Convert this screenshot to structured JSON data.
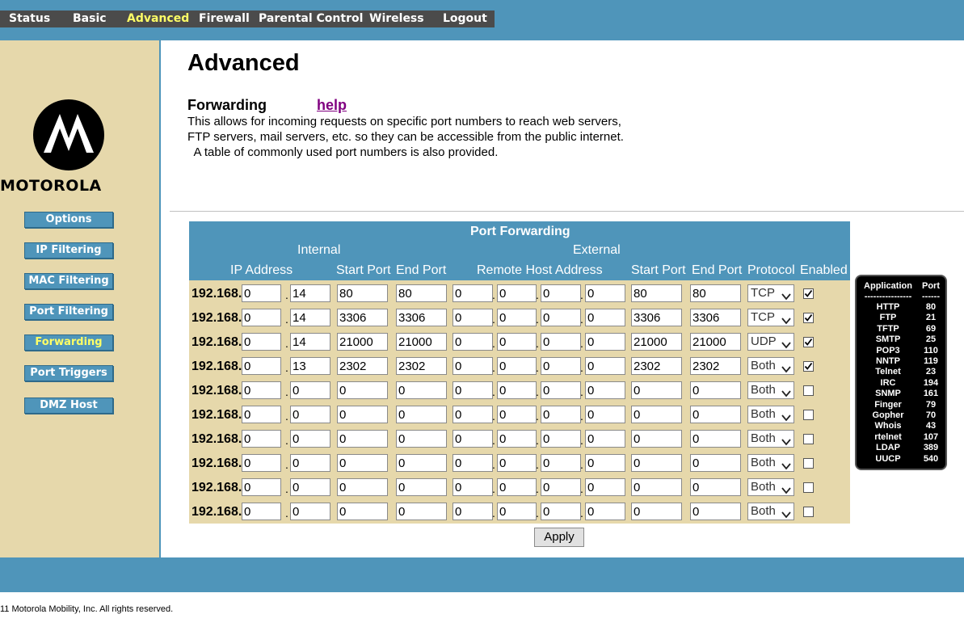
{
  "nav": [
    "Status",
    "Basic",
    "Advanced",
    "Firewall",
    "Parental Control",
    "Wireless",
    "Logout"
  ],
  "active_nav": "Advanced",
  "brand": "MOTOROLA",
  "sidebar": [
    "Options",
    "IP Filtering",
    "MAC Filtering",
    "Port Filtering",
    "Forwarding",
    "Port Triggers",
    "DMZ Host"
  ],
  "active_sidebar": "Forwarding",
  "page_title": "Advanced",
  "section_title": "Forwarding",
  "help_label": "help",
  "description": [
    "This allows for incoming requests on specific port numbers to reach  web servers,",
    "FTP servers, mail servers, etc. so they can be accessible from the public internet.",
    "  A table of commonly used port numbers is also provided."
  ],
  "table": {
    "title": "Port Forwarding",
    "group_internal": "Internal",
    "group_external": "External",
    "col_ip": "IP Address",
    "col_start": "Start Port",
    "col_end": "End Port",
    "col_remote": "Remote Host Address",
    "col_ext_start": "Start Port",
    "col_ext_end": "End Port",
    "col_protocol": "Protocol",
    "col_enabled": "Enabled",
    "ip_prefix": "192.168.",
    "rows": [
      {
        "ip3": "0",
        "ip4": "14",
        "start": "80",
        "end": "80",
        "r1": "0",
        "r2": "0",
        "r3": "0",
        "r4": "0",
        "ext_start": "80",
        "ext_end": "80",
        "protocol": "TCP",
        "enabled": true
      },
      {
        "ip3": "0",
        "ip4": "14",
        "start": "3306",
        "end": "3306",
        "r1": "0",
        "r2": "0",
        "r3": "0",
        "r4": "0",
        "ext_start": "3306",
        "ext_end": "3306",
        "protocol": "TCP",
        "enabled": true
      },
      {
        "ip3": "0",
        "ip4": "14",
        "start": "21000",
        "end": "21000",
        "r1": "0",
        "r2": "0",
        "r3": "0",
        "r4": "0",
        "ext_start": "21000",
        "ext_end": "21000",
        "protocol": "UDP",
        "enabled": true
      },
      {
        "ip3": "0",
        "ip4": "13",
        "start": "2302",
        "end": "2302",
        "r1": "0",
        "r2": "0",
        "r3": "0",
        "r4": "0",
        "ext_start": "2302",
        "ext_end": "2302",
        "protocol": "Both",
        "enabled": true
      },
      {
        "ip3": "0",
        "ip4": "0",
        "start": "0",
        "end": "0",
        "r1": "0",
        "r2": "0",
        "r3": "0",
        "r4": "0",
        "ext_start": "0",
        "ext_end": "0",
        "protocol": "Both",
        "enabled": false
      },
      {
        "ip3": "0",
        "ip4": "0",
        "start": "0",
        "end": "0",
        "r1": "0",
        "r2": "0",
        "r3": "0",
        "r4": "0",
        "ext_start": "0",
        "ext_end": "0",
        "protocol": "Both",
        "enabled": false
      },
      {
        "ip3": "0",
        "ip4": "0",
        "start": "0",
        "end": "0",
        "r1": "0",
        "r2": "0",
        "r3": "0",
        "r4": "0",
        "ext_start": "0",
        "ext_end": "0",
        "protocol": "Both",
        "enabled": false
      },
      {
        "ip3": "0",
        "ip4": "0",
        "start": "0",
        "end": "0",
        "r1": "0",
        "r2": "0",
        "r3": "0",
        "r4": "0",
        "ext_start": "0",
        "ext_end": "0",
        "protocol": "Both",
        "enabled": false
      },
      {
        "ip3": "0",
        "ip4": "0",
        "start": "0",
        "end": "0",
        "r1": "0",
        "r2": "0",
        "r3": "0",
        "r4": "0",
        "ext_start": "0",
        "ext_end": "0",
        "protocol": "Both",
        "enabled": false
      },
      {
        "ip3": "0",
        "ip4": "0",
        "start": "0",
        "end": "0",
        "r1": "0",
        "r2": "0",
        "r3": "0",
        "r4": "0",
        "ext_start": "0",
        "ext_end": "0",
        "protocol": "Both",
        "enabled": false
      }
    ]
  },
  "apply_label": "Apply",
  "ports_panel": {
    "col_app": "Application",
    "col_port": "Port",
    "sep_app": "----------------",
    "sep_port": "------",
    "rows": [
      {
        "app": "HTTP",
        "port": "80"
      },
      {
        "app": "FTP",
        "port": "21"
      },
      {
        "app": "TFTP",
        "port": "69"
      },
      {
        "app": "SMTP",
        "port": "25"
      },
      {
        "app": "POP3",
        "port": "110"
      },
      {
        "app": "NNTP",
        "port": "119"
      },
      {
        "app": "Telnet",
        "port": "23"
      },
      {
        "app": "IRC",
        "port": "194"
      },
      {
        "app": "SNMP",
        "port": "161"
      },
      {
        "app": "Finger",
        "port": "79"
      },
      {
        "app": "Gopher",
        "port": "70"
      },
      {
        "app": "Whois",
        "port": "43"
      },
      {
        "app": "rtelnet",
        "port": "107"
      },
      {
        "app": "LDAP",
        "port": "389"
      },
      {
        "app": "UUCP",
        "port": "540"
      }
    ]
  },
  "copyright": "11 Motorola Mobility, Inc. All rights reserved.",
  "colors": {
    "header": "#4f95ba",
    "sidebar": "#e6d8ab",
    "nav": "#4b4b4b",
    "active": "#ffff66",
    "help": "#800080"
  }
}
